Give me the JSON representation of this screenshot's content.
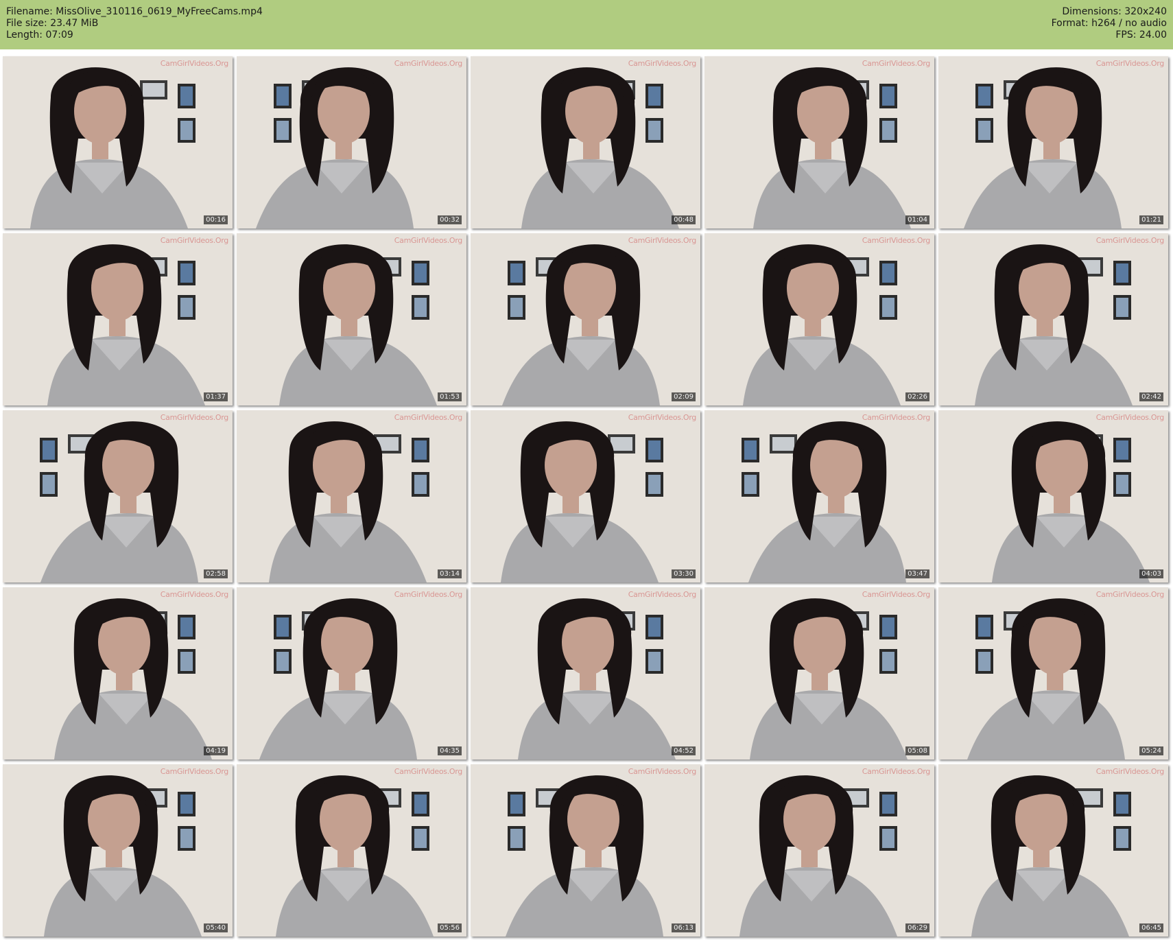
{
  "header": {
    "filename_label": "Filename: MissOlive_310116_0619_MyFreeCams.mp4",
    "filesize_label": "File size: 23.47 MiB",
    "length_label": "Length: 07:09",
    "dimensions_label": "Dimensions: 320x240",
    "format_label": "Format: h264 / no audio",
    "fps_label": "FPS: 24.00"
  },
  "watermark": "CamGirlVideos.Org",
  "thumbnails": [
    {
      "time": "00:16"
    },
    {
      "time": "00:32"
    },
    {
      "time": "00:48"
    },
    {
      "time": "01:04"
    },
    {
      "time": "01:21"
    },
    {
      "time": "01:37"
    },
    {
      "time": "01:53"
    },
    {
      "time": "02:09"
    },
    {
      "time": "02:26"
    },
    {
      "time": "02:42"
    },
    {
      "time": "02:58"
    },
    {
      "time": "03:14"
    },
    {
      "time": "03:30"
    },
    {
      "time": "03:47"
    },
    {
      "time": "04:03"
    },
    {
      "time": "04:19"
    },
    {
      "time": "04:35"
    },
    {
      "time": "04:52"
    },
    {
      "time": "05:08"
    },
    {
      "time": "05:24"
    },
    {
      "time": "05:40"
    },
    {
      "time": "05:56"
    },
    {
      "time": "06:13"
    },
    {
      "time": "06:29"
    },
    {
      "time": "06:45"
    }
  ],
  "colors": {
    "header_bg": "#b0cc80",
    "sweater": "#a9a9ab",
    "hair": "#1a1414",
    "skin": "#c4a090",
    "wall": "#e6e1da"
  }
}
